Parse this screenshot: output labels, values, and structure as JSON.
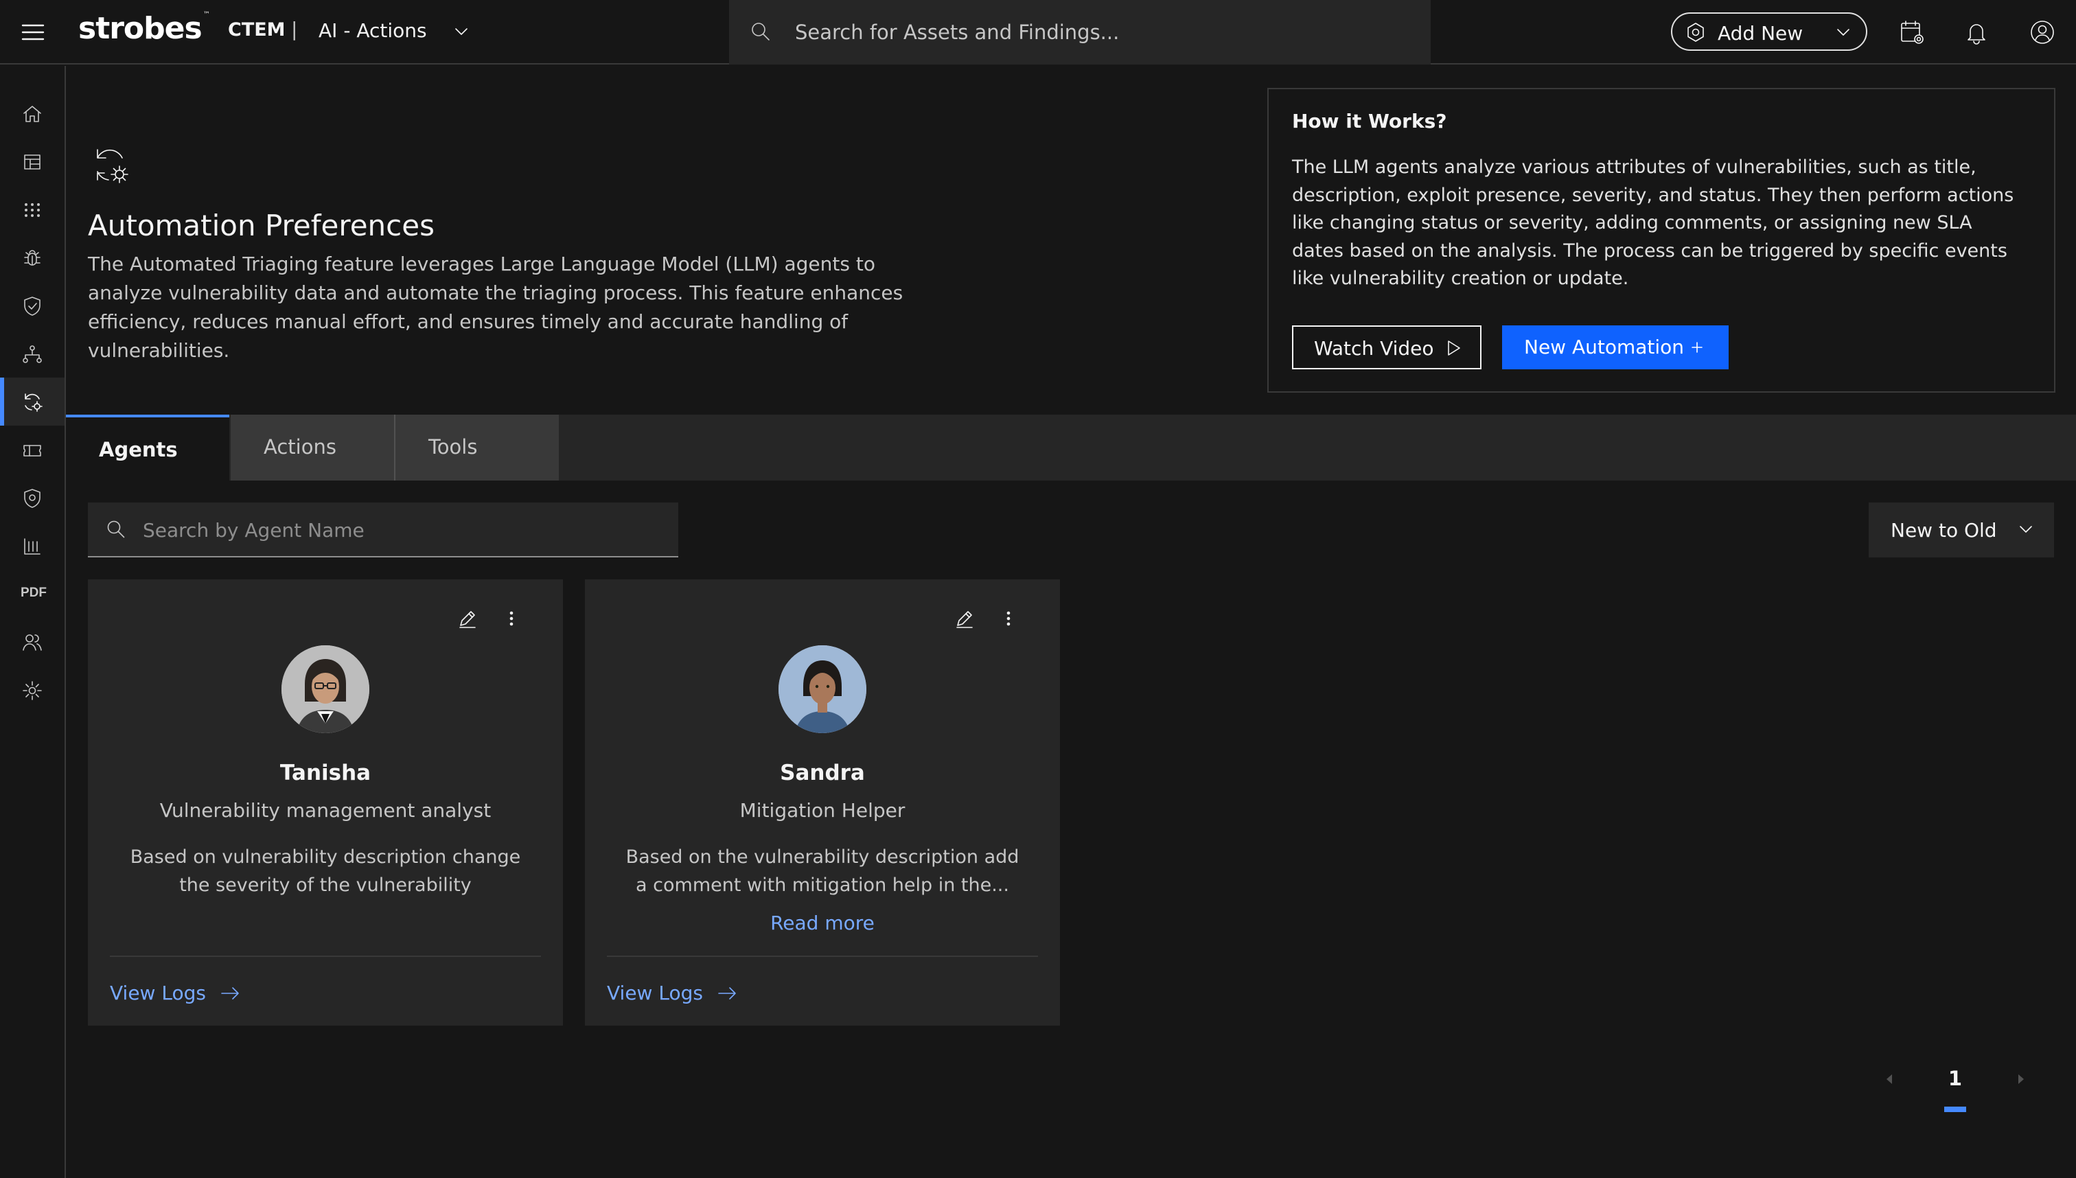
{
  "header": {
    "logo_text": "strobes",
    "logo_tm": "™",
    "product": "CTEM",
    "separator": "|",
    "context": "AI - Actions",
    "search_placeholder": "Search for Assets and Findings...",
    "add_new_label": "Add New"
  },
  "sidebar": {
    "items": [
      {
        "icon": "home-icon"
      },
      {
        "icon": "dashboard-icon"
      },
      {
        "icon": "apps-grid-icon"
      },
      {
        "icon": "bug-icon"
      },
      {
        "icon": "shield-check-icon"
      },
      {
        "icon": "network-icon"
      },
      {
        "icon": "automation-icon",
        "active": true
      },
      {
        "icon": "ticket-icon"
      },
      {
        "icon": "location-shield-icon"
      },
      {
        "icon": "reports-icon"
      },
      {
        "icon": "pdf-icon",
        "text": "PDF"
      },
      {
        "icon": "users-icon"
      },
      {
        "icon": "settings-icon"
      }
    ]
  },
  "page": {
    "title": "Automation Preferences",
    "description": "The Automated Triaging feature leverages Large Language Model (LLM) agents to analyze vulnerability data and automate the triaging process. This feature enhances efficiency, reduces manual effort, and ensures timely and accurate handling of vulnerabilities."
  },
  "how_it_works": {
    "title": "How it Works?",
    "text": "The LLM agents analyze various attributes of vulnerabilities, such as title, description, exploit presence, severity, and status. They then perform actions like changing status or severity, adding comments, or assigning new SLA dates based on the analysis. The process can be triggered by specific events like vulnerability creation or update.",
    "watch_video_label": "Watch Video",
    "new_automation_label": "New Automation"
  },
  "tabs": [
    {
      "label": "Agents",
      "active": true
    },
    {
      "label": "Actions",
      "active": false
    },
    {
      "label": "Tools",
      "active": false
    }
  ],
  "toolbar": {
    "search_placeholder": "Search by Agent Name",
    "sort_label": "New to Old"
  },
  "agents": [
    {
      "name": "Tanisha",
      "role": "Vulnerability management analyst",
      "description": "Based on vulnerability description change the severity of the vulnerability",
      "read_more": "",
      "view_logs": "View Logs"
    },
    {
      "name": "Sandra",
      "role": "Mitigation Helper",
      "description": "Based on the vulnerability description add a comment with mitigation help in the...",
      "read_more": "Read more",
      "view_logs": "View Logs"
    }
  ],
  "pagination": {
    "current_page": "1"
  },
  "colors": {
    "background": "#161616",
    "surface": "#262626",
    "accent": "#0f62fe",
    "link": "#78a9ff",
    "active_indicator": "#4589ff"
  }
}
